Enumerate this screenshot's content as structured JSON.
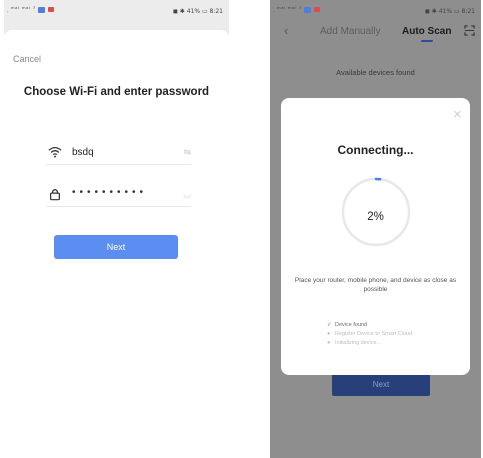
{
  "left": {
    "status": {
      "left": "᷊ ᵐᵃˡ ᵐᵃˡ ⁷ ",
      "right": "◼ ✱ 41% ▭ 8:21"
    },
    "cancel_label": "Cancel",
    "title": "Choose Wi-Fi and enter password",
    "wifi": {
      "icon": "wifi-icon",
      "ssid": "bsdq",
      "action": "⇋"
    },
    "password": {
      "icon": "lock-icon",
      "masked": "••••••••••",
      "action": "◡"
    },
    "next_label": "Next"
  },
  "right": {
    "status": {
      "left": "᷊ ᵐᵃˡ ᵐᵃˡ ⁷ ",
      "right": "◼ ✱ 41% ▭ 8:21"
    },
    "nav": {
      "back": "‹",
      "tab_manual": "Add Manually",
      "tab_auto": "Auto Scan",
      "scan_icon": "scan-icon"
    },
    "available_label": "Available devices found",
    "bg_next_label": "Next",
    "modal": {
      "close": "✕",
      "title": "Connecting...",
      "progress": 0.02,
      "percent_label": "2%",
      "message": "Place your router, mobile phone, and device as close as possible",
      "steps": [
        {
          "mark": "✓",
          "label": "Device found",
          "state": "done"
        },
        {
          "mark": "●",
          "label": "Register Device to Smart Cloud",
          "state": "pending"
        },
        {
          "mark": "●",
          "label": "Initializing device...",
          "state": "pending"
        }
      ]
    }
  },
  "colors": {
    "accent": "#5b8ef0",
    "ring": "#e8e8e8",
    "ring_progress": "#4a7de8",
    "dim_button": "#27407a"
  }
}
